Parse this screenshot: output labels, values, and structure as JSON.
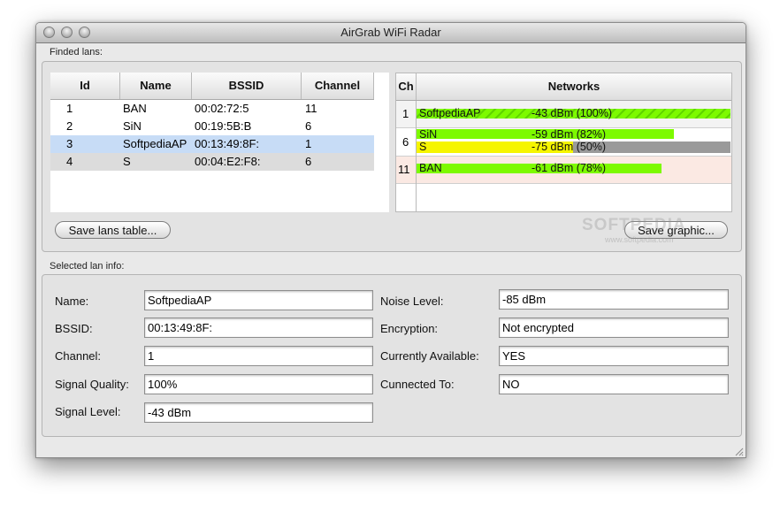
{
  "window": {
    "title": "AirGrab WiFi Radar"
  },
  "lans": {
    "section_label": "Finded lans:",
    "columns": [
      "Id",
      "Name",
      "BSSID",
      "Channel"
    ],
    "rows": [
      {
        "id": "1",
        "name": "BAN",
        "bssid": "00:02:72:5",
        "channel": "11"
      },
      {
        "id": "2",
        "name": "SiN",
        "bssid": "00:19:5B:B",
        "channel": "6"
      },
      {
        "id": "3",
        "name": "SoftpediaAP",
        "bssid": "00:13:49:8F:",
        "channel": "1"
      },
      {
        "id": "4",
        "name": "S",
        "bssid": "00:04:E2:F8:",
        "channel": "6"
      }
    ],
    "save_button": "Save lans table..."
  },
  "graph": {
    "columns": [
      "Ch",
      "Networks"
    ],
    "groups": [
      {
        "channel": "1",
        "bars": [
          {
            "name": "SoftpediaAP",
            "text": "-43 dBm (100%)",
            "quality": 100,
            "color": "#7dfa00"
          }
        ]
      },
      {
        "channel": "6",
        "bars": [
          {
            "name": "SiN",
            "text": "-59 dBm (82%)",
            "quality": 82,
            "color": "#7dfa00"
          },
          {
            "name": "S",
            "text": "-75 dBm (50%)",
            "quality": 50,
            "color": "#f6f500"
          }
        ]
      },
      {
        "channel": "11",
        "bars": [
          {
            "name": "BAN",
            "text": "-61 dBm (78%)",
            "quality": 78,
            "color": "#7dfa00"
          }
        ]
      }
    ],
    "save_button": "Save graphic..."
  },
  "info": {
    "section_label": "Selected lan info:",
    "name": {
      "label": "Name:",
      "value": "SoftpediaAP"
    },
    "bssid": {
      "label": "BSSID:",
      "value": "00:13:49:8F:"
    },
    "channel": {
      "label": "Channel:",
      "value": "1"
    },
    "signal_quality": {
      "label": "Signal Quality:",
      "value": "100%"
    },
    "signal_level": {
      "label": "Signal Level:",
      "value": "-43 dBm"
    },
    "noise_level": {
      "label": "Noise Level:",
      "value": "-85 dBm"
    },
    "encryption": {
      "label": "Encryption:",
      "value": "Not encrypted"
    },
    "currently_available": {
      "label": "Currently Available:",
      "value": "YES"
    },
    "connected_to": {
      "label": "Cunnected To:",
      "value": "NO"
    }
  },
  "watermark": {
    "text": "SOFTPEDIA",
    "sub": "www.softpedia.com"
  }
}
